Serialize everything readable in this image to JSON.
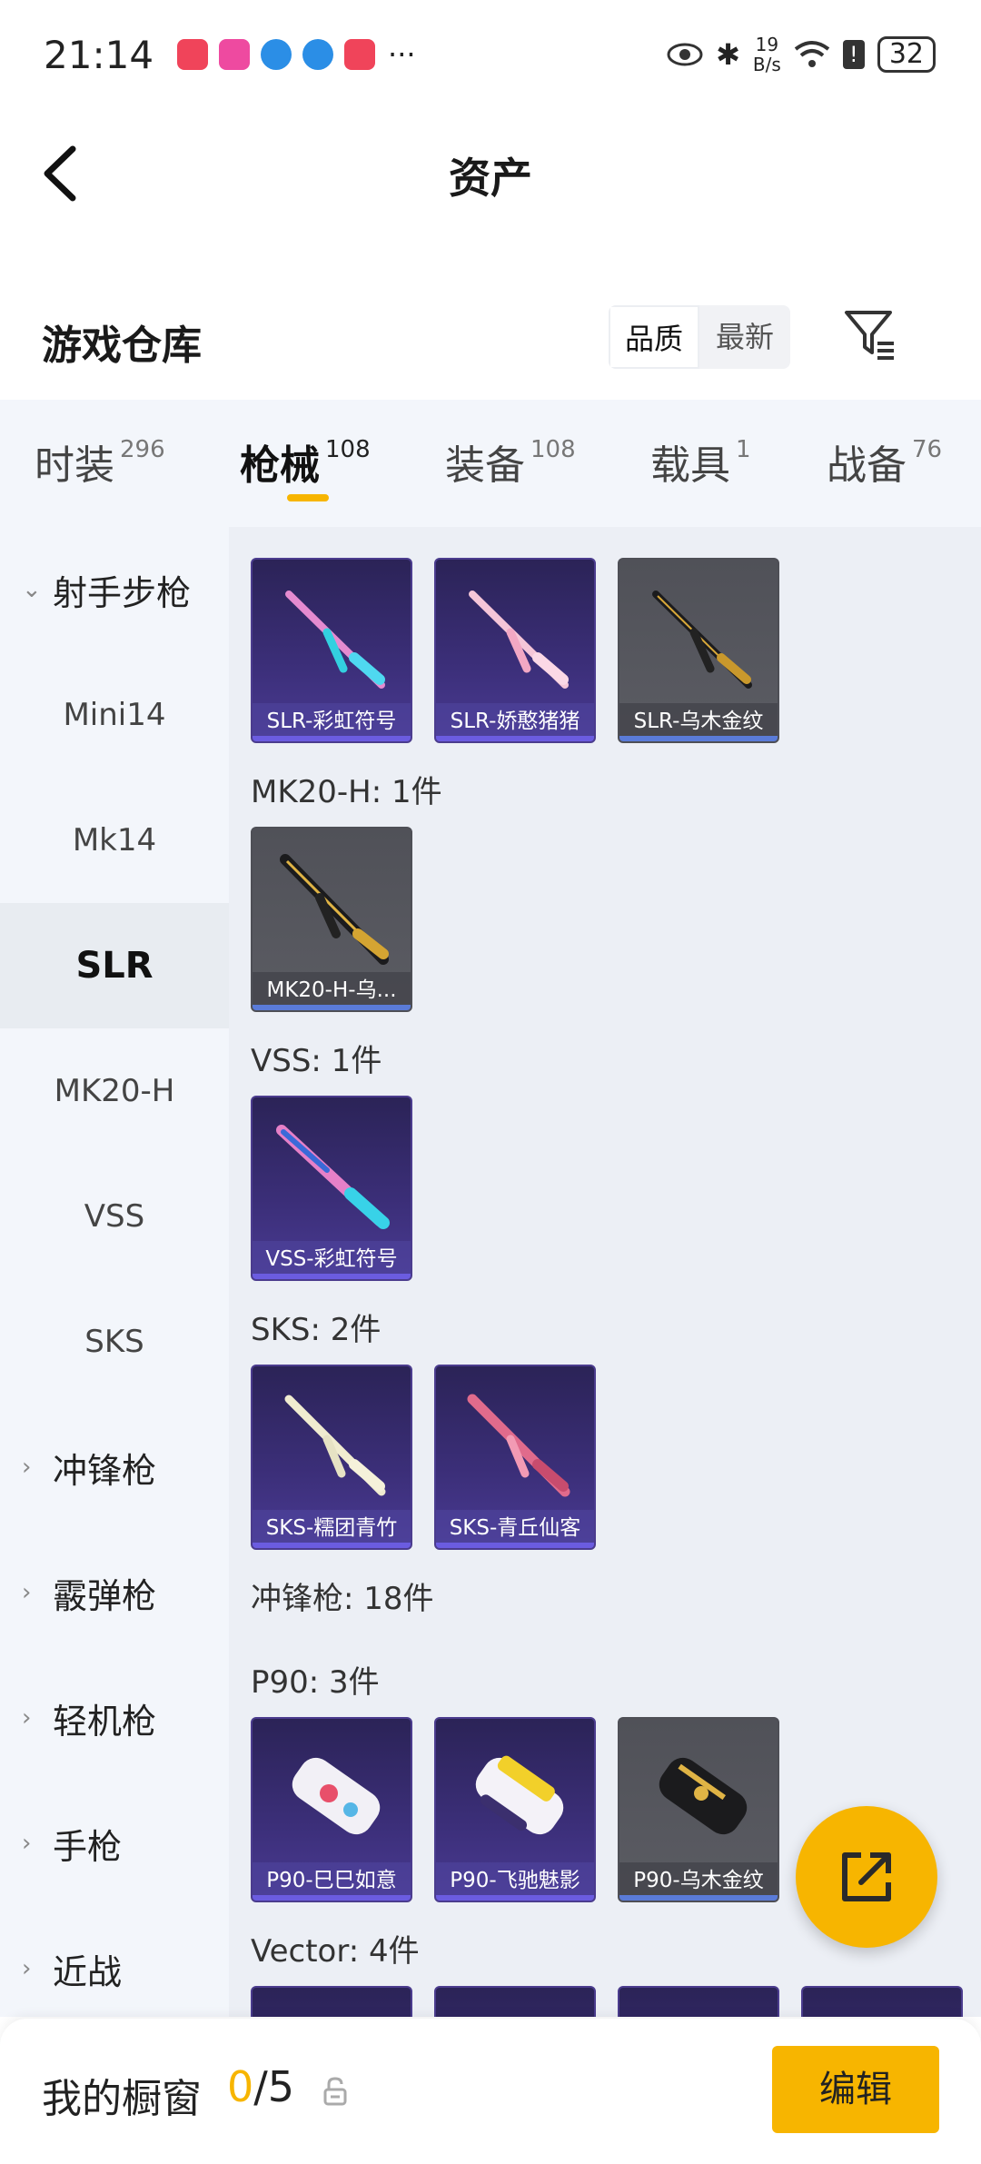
{
  "status_bar": {
    "time": "21:14",
    "net_speed_top": "19",
    "net_speed_bottom": "B/s",
    "battery": "32",
    "overflow": "···"
  },
  "nav": {
    "title": "资产"
  },
  "section": {
    "title": "游戏仓库",
    "sort_options": [
      "品质",
      "最新"
    ]
  },
  "tabs": [
    {
      "label": "时装",
      "count": "296"
    },
    {
      "label": "枪械",
      "count": "108"
    },
    {
      "label": "装备",
      "count": "108"
    },
    {
      "label": "载具",
      "count": "1"
    },
    {
      "label": "战备",
      "count": "76"
    }
  ],
  "sidebar": {
    "items": [
      {
        "label": "射手步枪",
        "type": "group",
        "chevron": "⌄"
      },
      {
        "label": "Mini14",
        "type": "sub"
      },
      {
        "label": "Mk14",
        "type": "sub"
      },
      {
        "label": "SLR",
        "type": "sub"
      },
      {
        "label": "MK20-H",
        "type": "sub"
      },
      {
        "label": "VSS",
        "type": "sub"
      },
      {
        "label": "SKS",
        "type": "sub"
      },
      {
        "label": "冲锋枪",
        "type": "group",
        "chevron": "›"
      },
      {
        "label": "霰弹枪",
        "type": "group",
        "chevron": "›"
      },
      {
        "label": "轻机枪",
        "type": "group",
        "chevron": "›"
      },
      {
        "label": "手枪",
        "type": "group",
        "chevron": "›"
      },
      {
        "label": "近战",
        "type": "group",
        "chevron": "›"
      }
    ]
  },
  "content": {
    "groups": [
      {
        "label": "",
        "items": [
          {
            "name": "SLR-彩虹符号",
            "style": "purple",
            "gun": "rainbow"
          },
          {
            "name": "SLR-娇憨猪猪",
            "style": "purple",
            "gun": "pink"
          },
          {
            "name": "SLR-乌木金纹",
            "style": "grey",
            "gun": "gold"
          }
        ]
      },
      {
        "label": "MK20-H: 1件",
        "items": [
          {
            "name": "MK20-H-乌...",
            "style": "grey",
            "gun": "gold"
          }
        ]
      },
      {
        "label": "VSS: 1件",
        "items": [
          {
            "name": "VSS-彩虹符号",
            "style": "purple",
            "gun": "rainbow"
          }
        ]
      },
      {
        "label": "SKS: 2件",
        "items": [
          {
            "name": "SKS-糯团青竹",
            "style": "purple",
            "gun": "cream"
          },
          {
            "name": "SKS-青丘仙客",
            "style": "purple",
            "gun": "pink"
          }
        ]
      },
      {
        "label": "冲锋枪: 18件",
        "items": []
      },
      {
        "label": "P90: 3件",
        "items": [
          {
            "name": "P90-巳巳如意",
            "style": "purple",
            "gun": "white"
          },
          {
            "name": "P90-飞驰魅影",
            "style": "purple",
            "gun": "yellow"
          },
          {
            "name": "P90-乌木金纹",
            "style": "grey",
            "gun": "gold"
          }
        ]
      },
      {
        "label": "Vector: 4件",
        "items": []
      }
    ]
  },
  "bottom_bar": {
    "title": "我的橱窗",
    "current": "0",
    "total": "/5",
    "edit_label": "编辑"
  },
  "colors": {
    "accent": "#f7b500",
    "card_purple": "#3c2f7a",
    "card_grey": "#55565d"
  }
}
